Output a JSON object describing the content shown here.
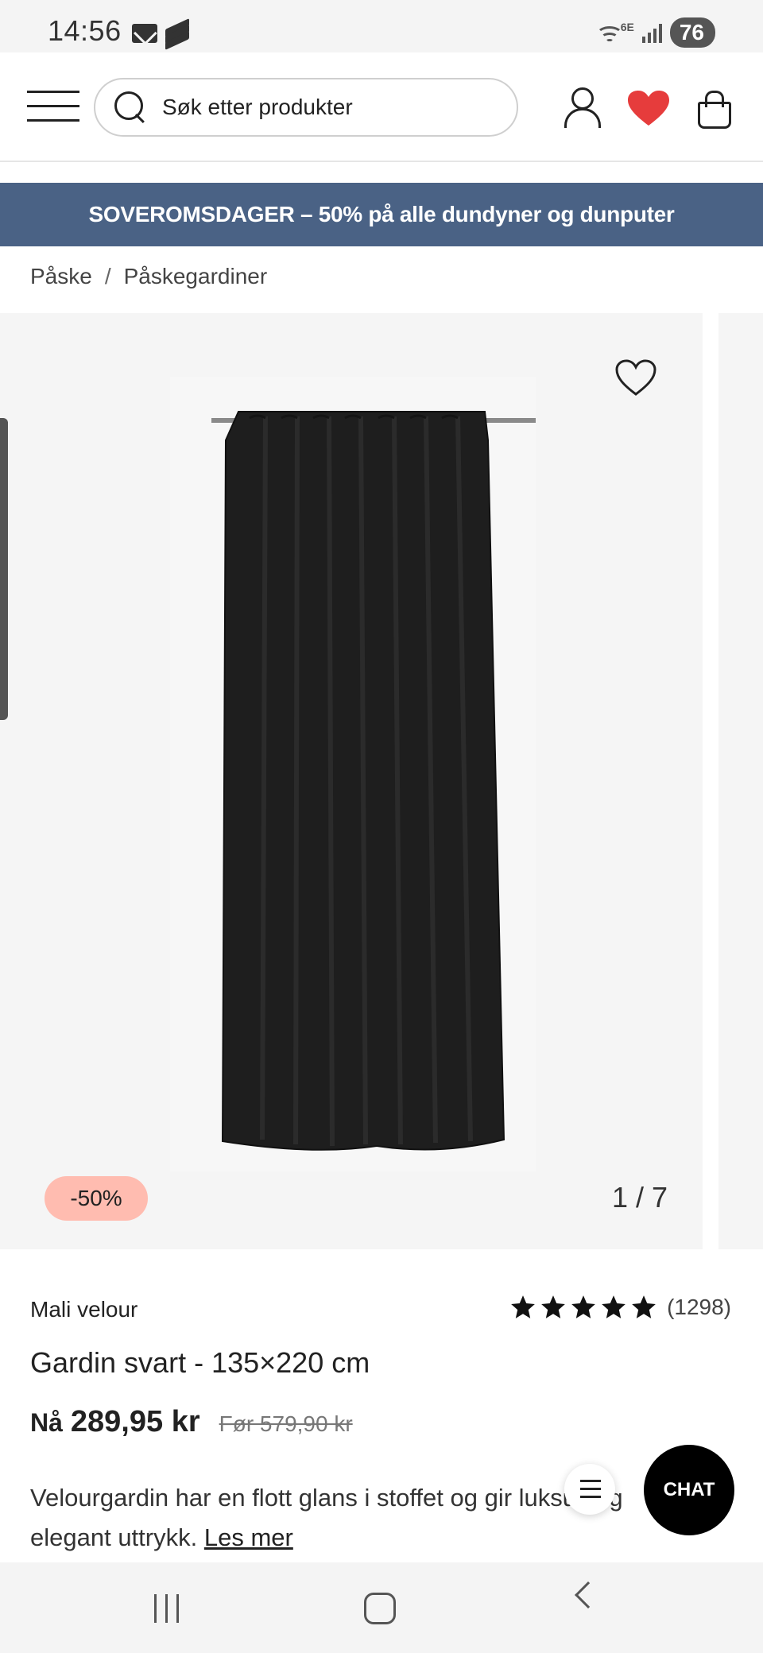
{
  "status_bar": {
    "time": "14:56",
    "network": "6E",
    "battery": "76"
  },
  "header": {
    "search_placeholder": "Søk etter produkter",
    "icons": [
      "menu-icon",
      "search-icon",
      "user-icon",
      "heart-icon",
      "shopping-bag-icon"
    ]
  },
  "promo": {
    "text": "SOVEROMSDAGER – 50% på alle dundyner og dunputer",
    "color": "#4a6285"
  },
  "breadcrumb": {
    "items": [
      "Påske",
      "Påskegardiner"
    ],
    "separator": "/"
  },
  "gallery": {
    "discount_badge": "-50%",
    "counter": "1 / 7",
    "badge_color": "#ffbcb0"
  },
  "product": {
    "brand": "Mali velour",
    "rating_stars": 5,
    "review_count": "(1298)",
    "title": "Gardin svart - 135×220 cm",
    "price_now_label": "Nå",
    "price_now": "289,95 kr",
    "price_before": "Før 579,90 kr",
    "description": "Velourgardin har en flott glans i stoffet og gir luksus og elegant uttrykk.",
    "read_more": "Les mer"
  },
  "chat": {
    "label": "CHAT"
  },
  "colors": {
    "heart_red": "#e63c3c",
    "chat_bg": "#000000"
  }
}
